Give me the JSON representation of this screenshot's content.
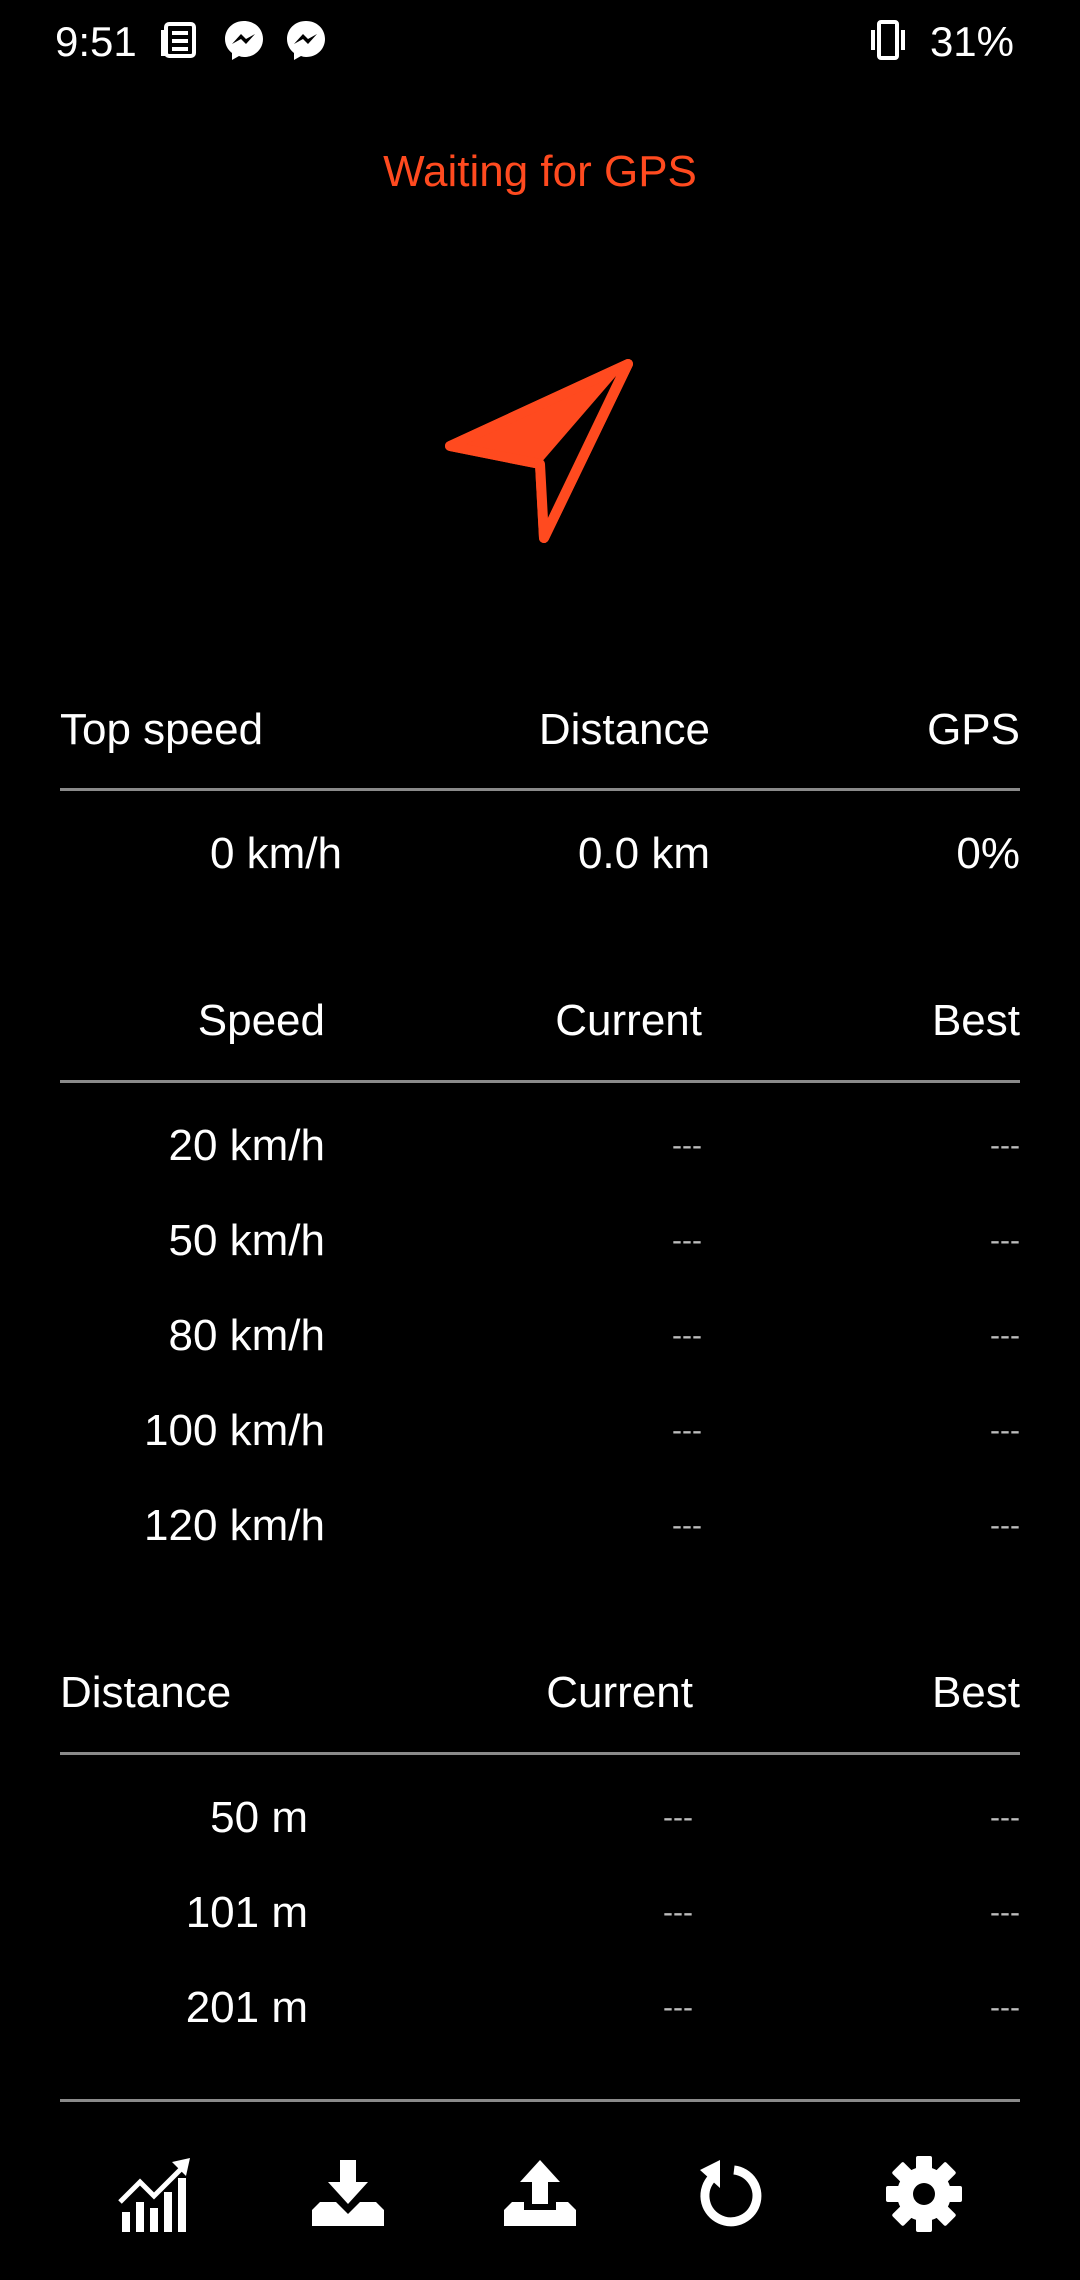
{
  "status_bar": {
    "time": "9:51",
    "battery": "31%",
    "icons": [
      "news-icon",
      "messenger-icon",
      "messenger-icon",
      "vibrate-icon"
    ]
  },
  "gps_status": {
    "text": "Waiting for GPS",
    "color": "#FF4A1F"
  },
  "summary": {
    "headers": [
      "Top speed",
      "Distance",
      "GPS"
    ],
    "values": [
      "0 km/h",
      "0.0 km",
      "0%"
    ]
  },
  "speed_table": {
    "headers": [
      "Speed",
      "Current",
      "Best"
    ],
    "rows": [
      {
        "label": "20 km/h",
        "current": "---",
        "best": "---"
      },
      {
        "label": "50 km/h",
        "current": "---",
        "best": "---"
      },
      {
        "label": "80 km/h",
        "current": "---",
        "best": "---"
      },
      {
        "label": "100 km/h",
        "current": "---",
        "best": "---"
      },
      {
        "label": "120 km/h",
        "current": "---",
        "best": "---"
      }
    ]
  },
  "distance_table": {
    "headers": [
      "Distance",
      "Current",
      "Best"
    ],
    "rows": [
      {
        "label": "50 m",
        "current": "---",
        "best": "---"
      },
      {
        "label": "101 m",
        "current": "---",
        "best": "---"
      },
      {
        "label": "201 m",
        "current": "---",
        "best": "---"
      }
    ]
  },
  "bottom_nav": {
    "icons": [
      "chart-icon",
      "download-icon",
      "upload-icon",
      "reset-icon",
      "settings-icon"
    ]
  },
  "colors": {
    "accent": "#FF4A1F",
    "background": "#000000",
    "text": "#FFFFFF",
    "rule": "#8A8A8A"
  }
}
